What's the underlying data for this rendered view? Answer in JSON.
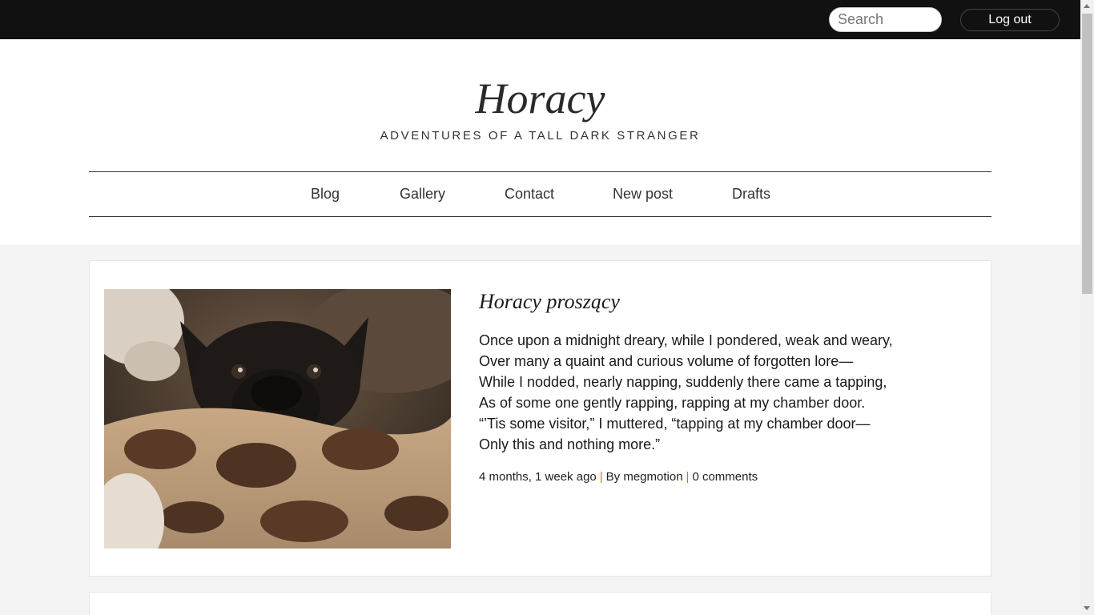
{
  "topbar": {
    "search_placeholder": "Search",
    "logout_label": "Log out"
  },
  "site": {
    "title": "Horacy",
    "tagline": "ADVENTURES OF A TALL DARK STRANGER"
  },
  "nav": {
    "items": [
      {
        "label": "Blog"
      },
      {
        "label": "Gallery"
      },
      {
        "label": "Contact"
      },
      {
        "label": "New post"
      },
      {
        "label": "Drafts"
      }
    ]
  },
  "post": {
    "title": "Horacy proszący",
    "lines": [
      "Once upon a midnight dreary, while I pondered, weak and weary,",
      "Over many a quaint and curious volume of forgotten lore—",
      "While I nodded, nearly napping, suddenly there came a tapping,",
      "As of some one gently rapping, rapping at my chamber door.",
      "“’Tis some visitor,” I muttered, “tapping at my chamber door—",
      "Only this and nothing more.”"
    ],
    "meta": {
      "time": "4 months, 1 week ago",
      "separator": "|",
      "author": "By megmotion",
      "comments": "0 comments"
    }
  },
  "colors": {
    "topbar": "#111111",
    "page_bg": "#f4f4f4",
    "meta_separator": "#b08a00"
  }
}
